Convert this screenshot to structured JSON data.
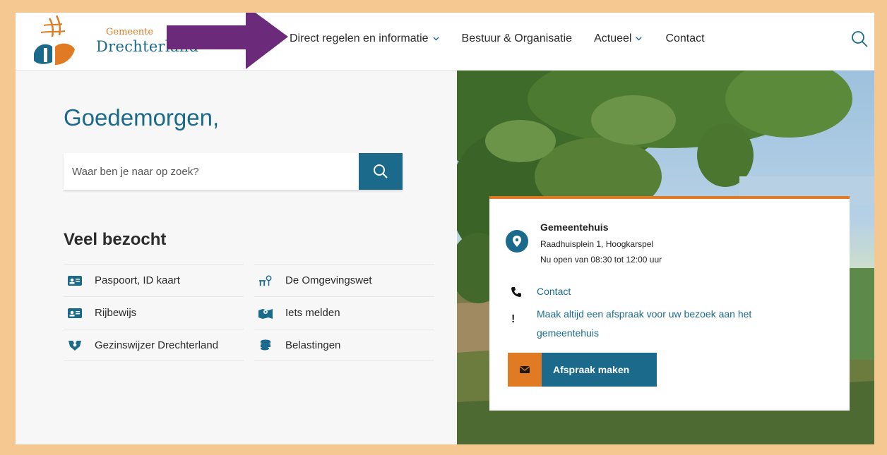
{
  "header": {
    "logo_small": "Gemeente",
    "logo_big": "Drechterland",
    "nav": [
      {
        "label": "Direct regelen en informatie",
        "has_dropdown": true
      },
      {
        "label": "Bestuur & Organisatie",
        "has_dropdown": false
      },
      {
        "label": "Actueel",
        "has_dropdown": true
      },
      {
        "label": "Contact",
        "has_dropdown": false
      }
    ],
    "search_icon": "search-icon"
  },
  "main": {
    "greeting": "Goedemorgen,",
    "search": {
      "placeholder": "Waar ben je naar op zoek?",
      "value": ""
    },
    "popular_title": "Veel bezocht",
    "popular_links": [
      {
        "label": "Paspoort, ID kaart",
        "icon": "id-card-icon"
      },
      {
        "label": "De Omgevingswet",
        "icon": "environment-icon"
      },
      {
        "label": "Rijbewijs",
        "icon": "license-icon"
      },
      {
        "label": "Iets melden",
        "icon": "map-report-icon"
      },
      {
        "label": "Gezinswijzer Drechterland",
        "icon": "family-icon"
      },
      {
        "label": "Belastingen",
        "icon": "coins-icon"
      }
    ]
  },
  "card": {
    "title": "Gemeentehuis",
    "address": "Raadhuisplein 1, Hoogkarspel",
    "hours": "Nu open van 08:30 tot 12:00 uur",
    "contact_link": "Contact",
    "notice_link": "Maak altijd een afspraak voor uw bezoek aan het gemeentehuis",
    "appointment_button": "Afspraak maken"
  },
  "colors": {
    "brand_blue": "#1b6a8c",
    "brand_orange": "#e07b24",
    "frame": "#f5c891",
    "arrow": "#6b2a7a"
  }
}
